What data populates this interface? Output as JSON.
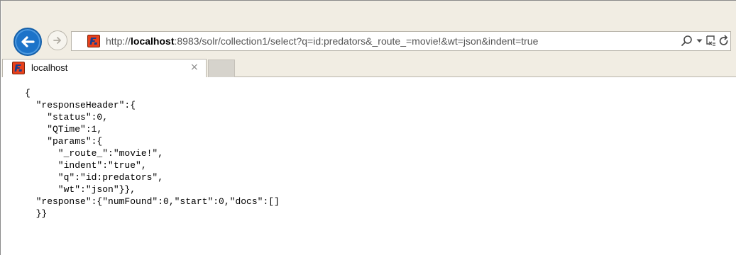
{
  "browser": {
    "url": {
      "prefix": "http://",
      "host": "localhost",
      "rest": ":8983/solr/collection1/select?q=id:predators&_route_=movie!&wt=json&indent=true"
    },
    "tab": {
      "title": "localhost",
      "close_glyph": "×"
    },
    "icons": [
      "back-arrow-icon",
      "forward-arrow-icon",
      "site-favicon-icon",
      "search-icon",
      "dropdown-arrow-icon",
      "compatibility-view-icon",
      "refresh-icon",
      "tab-close-icon"
    ],
    "colors": {
      "back_button": "#1c73c9",
      "chrome_background": "#f1ede3",
      "favicon": "#e9411c"
    }
  },
  "content": {
    "lines": [
      "{",
      "  \"responseHeader\":{",
      "    \"status\":0,",
      "    \"QTime\":1,",
      "    \"params\":{",
      "      \"_route_\":\"movie!\",",
      "      \"indent\":\"true\",",
      "      \"q\":\"id:predators\",",
      "      \"wt\":\"json\"}},",
      "  \"response\":{\"numFound\":0,\"start\":0,\"docs\":[]",
      "  }}"
    ]
  }
}
